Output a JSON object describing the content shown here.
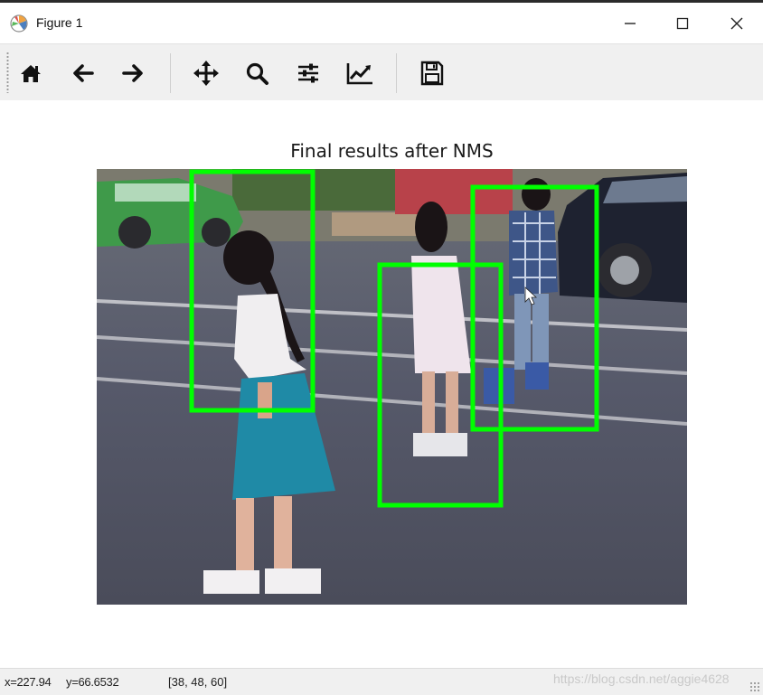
{
  "window": {
    "title": "Figure 1",
    "controls": [
      "minimize",
      "maximize",
      "close"
    ]
  },
  "toolbar": {
    "buttons": [
      {
        "name": "home",
        "icon": "home-icon"
      },
      {
        "name": "back",
        "icon": "arrow-left-icon"
      },
      {
        "name": "forward",
        "icon": "arrow-right-icon"
      },
      {
        "name": "pan",
        "icon": "move-icon"
      },
      {
        "name": "zoom",
        "icon": "magnifier-icon"
      },
      {
        "name": "subplots",
        "icon": "sliders-icon"
      },
      {
        "name": "edit-axes",
        "icon": "line-chart-icon"
      },
      {
        "name": "save",
        "icon": "floppy-disk-icon"
      }
    ]
  },
  "plot": {
    "title": "Final results after NMS",
    "box_color": "#00ff00",
    "detections": 3
  },
  "status": {
    "coords": "x=227.94     y=66.6532",
    "rgb": "[38, 48, 60]"
  },
  "watermark": "https://blog.csdn.net/aggie4628"
}
